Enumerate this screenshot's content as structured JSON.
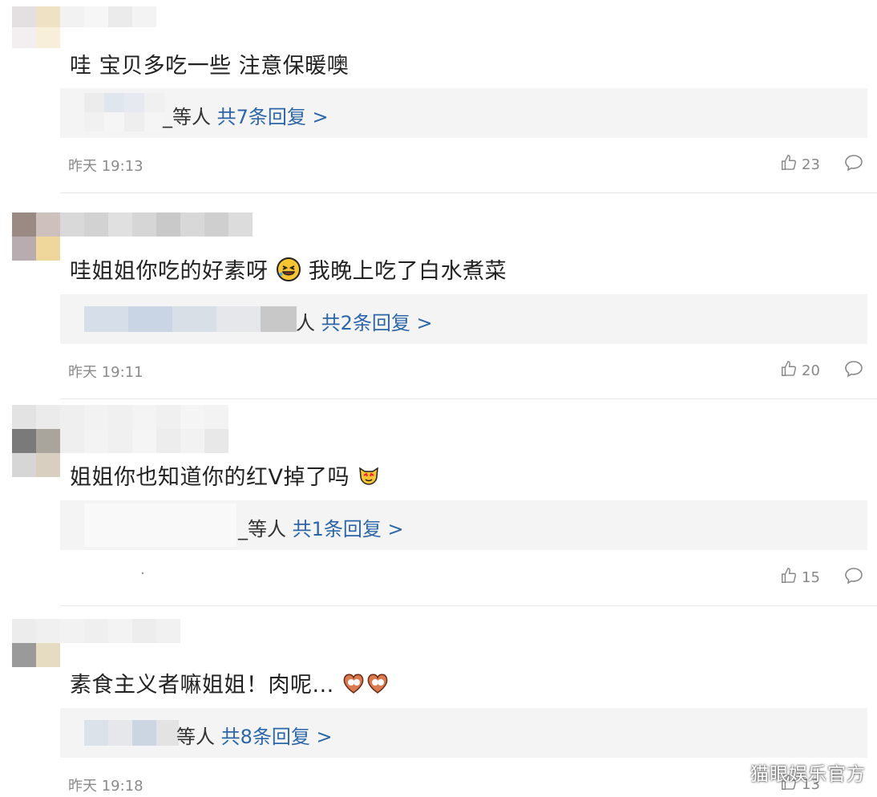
{
  "comments": [
    {
      "text": "哇 宝贝多吃一些 注意保暖噢",
      "reply_prefix": "_等人 ",
      "reply_link": "共7条回复 >",
      "time": "昨天 19:13",
      "likes": "23"
    },
    {
      "text_before_emoji": "哇姐姐你吃的好素呀",
      "text_after_emoji": "我晚上吃了白水煮菜",
      "reply_prefix": "人 ",
      "reply_link": "共2条回复 >",
      "time": "昨天 19:11",
      "likes": "20"
    },
    {
      "text": "姐姐你也知道你的红V掉了吗",
      "reply_prefix": "_等人 ",
      "reply_link": "共1条回复 >",
      "time": ".",
      "likes": "15"
    },
    {
      "text": "素食主义者嘛姐姐！肉呢...",
      "reply_prefix": "等人 ",
      "reply_link": "共8条回复 >",
      "time": "昨天 19:18",
      "likes": "13"
    }
  ],
  "icons": {
    "like": "thumbs-up-icon",
    "comment": "comment-bubble-icon"
  },
  "watermark": "猫眼娱乐官方",
  "colors": {
    "link": "#2d66a8",
    "reply_bg": "#f4f4f4",
    "meta_gray": "#8a8a8a"
  }
}
